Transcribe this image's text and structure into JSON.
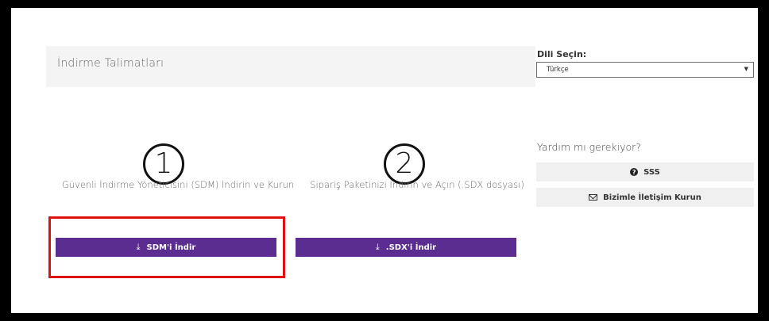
{
  "header": {
    "title": "İndirme Talimatları"
  },
  "language": {
    "label": "Dili Seçin:",
    "selected": "Türkçe",
    "caret": "▼"
  },
  "steps": [
    {
      "number": "1",
      "text": "Güvenli İndirme Yöneticisini (SDM) İndirin ve Kurun",
      "button_label": "SDM'i İndir"
    },
    {
      "number": "2",
      "text": "Sipariş Paketinizi İndirin ve Açın (.SDX dosyası)",
      "button_label": ".SDX'i İndir"
    }
  ],
  "icons": {
    "download": "download-icon",
    "question": "question-circle-icon",
    "mail": "envelope-icon"
  },
  "help": {
    "title": "Yardım mı gerekiyor?",
    "faq_label": "SSS",
    "contact_label": "Bizimle İletişim Kurun"
  },
  "colors": {
    "accent": "#5c2d91",
    "highlight": "#e01010",
    "panel": "#f4f4f4"
  }
}
